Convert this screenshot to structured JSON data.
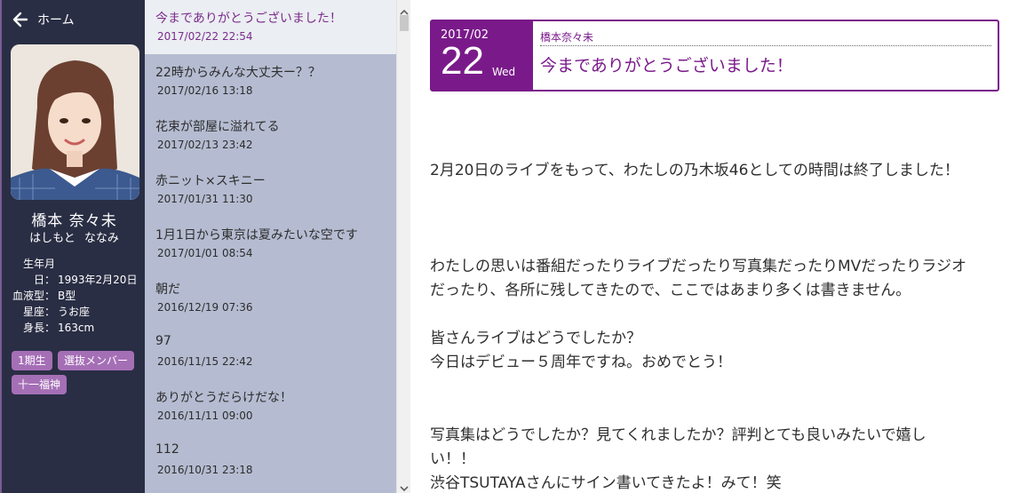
{
  "sidebar": {
    "home_label": "ホーム",
    "name": "橋本 奈々未",
    "kana": "はしもと ななみ",
    "info": [
      {
        "label": "生年月",
        "value": ""
      },
      {
        "label": "日：",
        "value": "1993年2月20日"
      },
      {
        "label": "血液型：",
        "value": "B型"
      },
      {
        "label": "星座：",
        "value": "うお座"
      },
      {
        "label": "身長：",
        "value": "163cm"
      }
    ],
    "tags": [
      "1期生",
      "選抜メンバー",
      "十一福神"
    ],
    "accent": "#a56fb6",
    "background": "#2a2e44"
  },
  "post_list": [
    {
      "title": "今までありがとうございました！",
      "date": "2017/02/22 22:54",
      "active": true
    },
    {
      "title": "22時からみんな大丈夫ー？？",
      "date": "2017/02/16 13:18"
    },
    {
      "title": "花束が部屋に溢れてる",
      "date": "2017/02/13 23:42"
    },
    {
      "title": "赤ニット×スキニー",
      "date": "2017/01/31 11:30"
    },
    {
      "title": "1月1日から東京は夏みたいな空です",
      "date": "2017/01/01 08:54"
    },
    {
      "title": "朝だ",
      "date": "2016/12/19 07:36"
    },
    {
      "title": "97",
      "date": "2016/11/15 22:42"
    },
    {
      "title": "ありがとうだらけだな！",
      "date": "2016/11/11 09:00"
    },
    {
      "title": "112",
      "date": "2016/10/31 23:18"
    }
  ],
  "article": {
    "year_month": "2017/02",
    "day": "22",
    "weekday": "Wed",
    "author": "橋本奈々未",
    "title": "今までありがとうございました！",
    "accent": "#7a1a8a",
    "paragraphs": [
      [
        "2月20日のライブをもって、わたしの乃木坂46としての時間は終了しました！"
      ],
      [
        "わたしの思いは番組だったりライブだったり写真集だったりMVだったりラジオ",
        "だったり、各所に残してきたので、ここではあまり多くは書きません。"
      ],
      [
        "皆さんライブはどうでしたか？",
        "今日はデビュー５周年ですね。おめでとう！"
      ],
      [
        "写真集はどうでしたか？見てくれましたか？評判とても良いみたいで嬉し",
        "い！！",
        "渋谷TSUTAYAさんにサイン書いてきたよ！みて！笑"
      ]
    ]
  },
  "icons": {
    "back": "arrow-left-icon",
    "scroll_up": "chevron-up-icon",
    "scroll_down": "chevron-down-icon"
  }
}
